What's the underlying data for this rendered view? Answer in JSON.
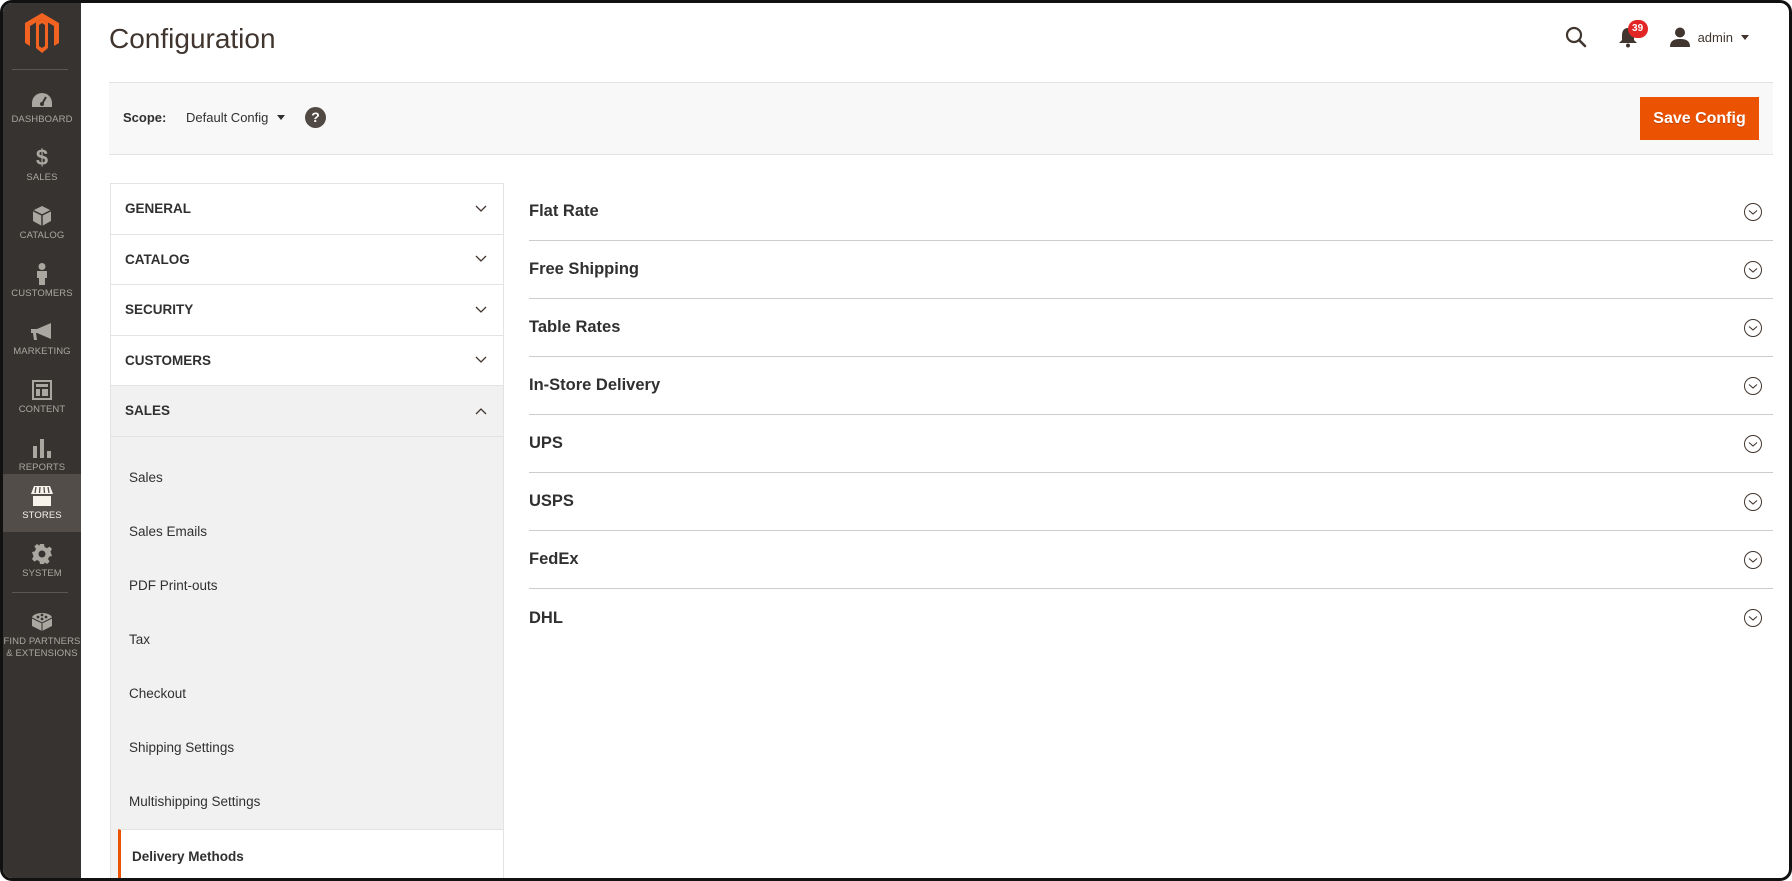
{
  "admin_menu": {
    "logo": "magento-logo",
    "items": [
      {
        "label": "Dashboard",
        "icon": "dashboard-icon",
        "active": false
      },
      {
        "label": "Sales",
        "icon": "dollar-icon",
        "active": false
      },
      {
        "label": "Catalog",
        "icon": "box-icon",
        "active": false
      },
      {
        "label": "Customers",
        "icon": "person-icon",
        "active": false
      },
      {
        "label": "Marketing",
        "icon": "megaphone-icon",
        "active": false
      },
      {
        "label": "Content",
        "icon": "layout-icon",
        "active": false
      },
      {
        "label": "Reports",
        "icon": "bar-chart-icon",
        "active": false
      },
      {
        "label": "Stores",
        "icon": "storefront-icon",
        "active": true
      },
      {
        "label": "System",
        "icon": "gear-icon",
        "active": false
      },
      {
        "label": "Find Partners & Extensions",
        "icon": "lego-brick-icon",
        "active": false
      }
    ]
  },
  "header": {
    "title": "Configuration",
    "notifications_count": "39",
    "user_name": "admin"
  },
  "scope": {
    "label": "Scope:",
    "value": "Default Config",
    "help": "?",
    "save_label": "Save Config"
  },
  "config_nav": {
    "tabs": [
      {
        "label": "General",
        "open": false
      },
      {
        "label": "Catalog",
        "open": false
      },
      {
        "label": "Security",
        "open": false
      },
      {
        "label": "Customers",
        "open": false
      },
      {
        "label": "Sales",
        "open": true
      }
    ],
    "sales_items": [
      {
        "label": "Sales",
        "active": false
      },
      {
        "label": "Sales Emails",
        "active": false
      },
      {
        "label": "PDF Print-outs",
        "active": false
      },
      {
        "label": "Tax",
        "active": false
      },
      {
        "label": "Checkout",
        "active": false
      },
      {
        "label": "Shipping Settings",
        "active": false
      },
      {
        "label": "Multishipping Settings",
        "active": false
      },
      {
        "label": "Delivery Methods",
        "active": true
      }
    ]
  },
  "sections": [
    {
      "title": "Flat Rate"
    },
    {
      "title": "Free Shipping"
    },
    {
      "title": "Table Rates"
    },
    {
      "title": "In-Store Delivery"
    },
    {
      "title": "UPS"
    },
    {
      "title": "USPS"
    },
    {
      "title": "FedEx"
    },
    {
      "title": "DHL"
    }
  ],
  "colors": {
    "accent": "#eb5202",
    "sidebar_bg": "#373330",
    "sidebar_active": "#524d49",
    "badge": "#e22626"
  }
}
